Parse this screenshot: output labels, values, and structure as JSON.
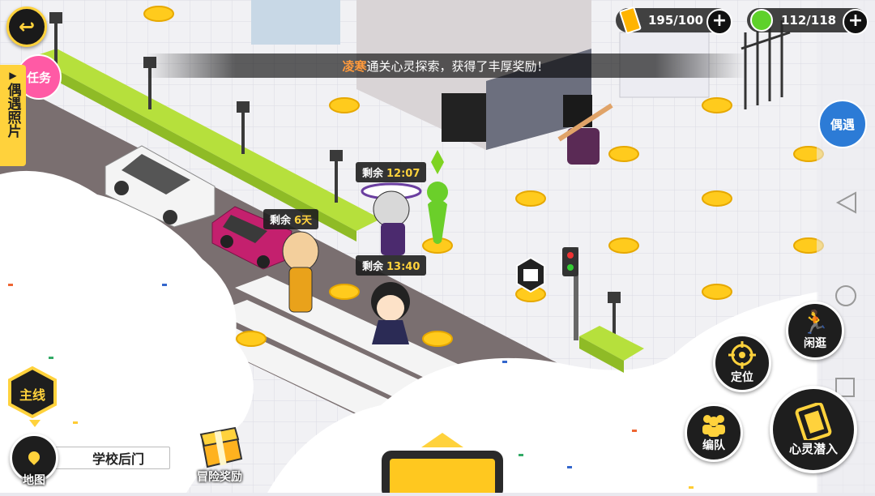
{
  "colors": {
    "accent_yellow": "#ffd23c",
    "hud_dark": "#1e1e1e",
    "notice_highlight": "#ff9a3c"
  },
  "resources": {
    "energy": {
      "icon": "battery-icon",
      "value": "195/100"
    },
    "gem": {
      "icon": "green-gem-icon",
      "value": "112/118"
    }
  },
  "notice": {
    "name": "凌寒",
    "text": "通关心灵探索，获得了丰厚奖励！"
  },
  "left_panel": {
    "task_label": "任务",
    "photo_label": "偶遇照片"
  },
  "encounter_button": {
    "label": "偶遇"
  },
  "timers": [
    {
      "prefix": "剩余",
      "value": "12:07"
    },
    {
      "prefix": "剩余",
      "value": "6天"
    },
    {
      "prefix": "剩余",
      "value": "13:40"
    }
  ],
  "bottom_left": {
    "mainline": "主线",
    "map": "地图",
    "location": "学校后门",
    "reward": "冒险奖励"
  },
  "actions": {
    "idle": "闲逛",
    "locate": "定位",
    "team": "编队",
    "dive": "心灵潜入"
  }
}
